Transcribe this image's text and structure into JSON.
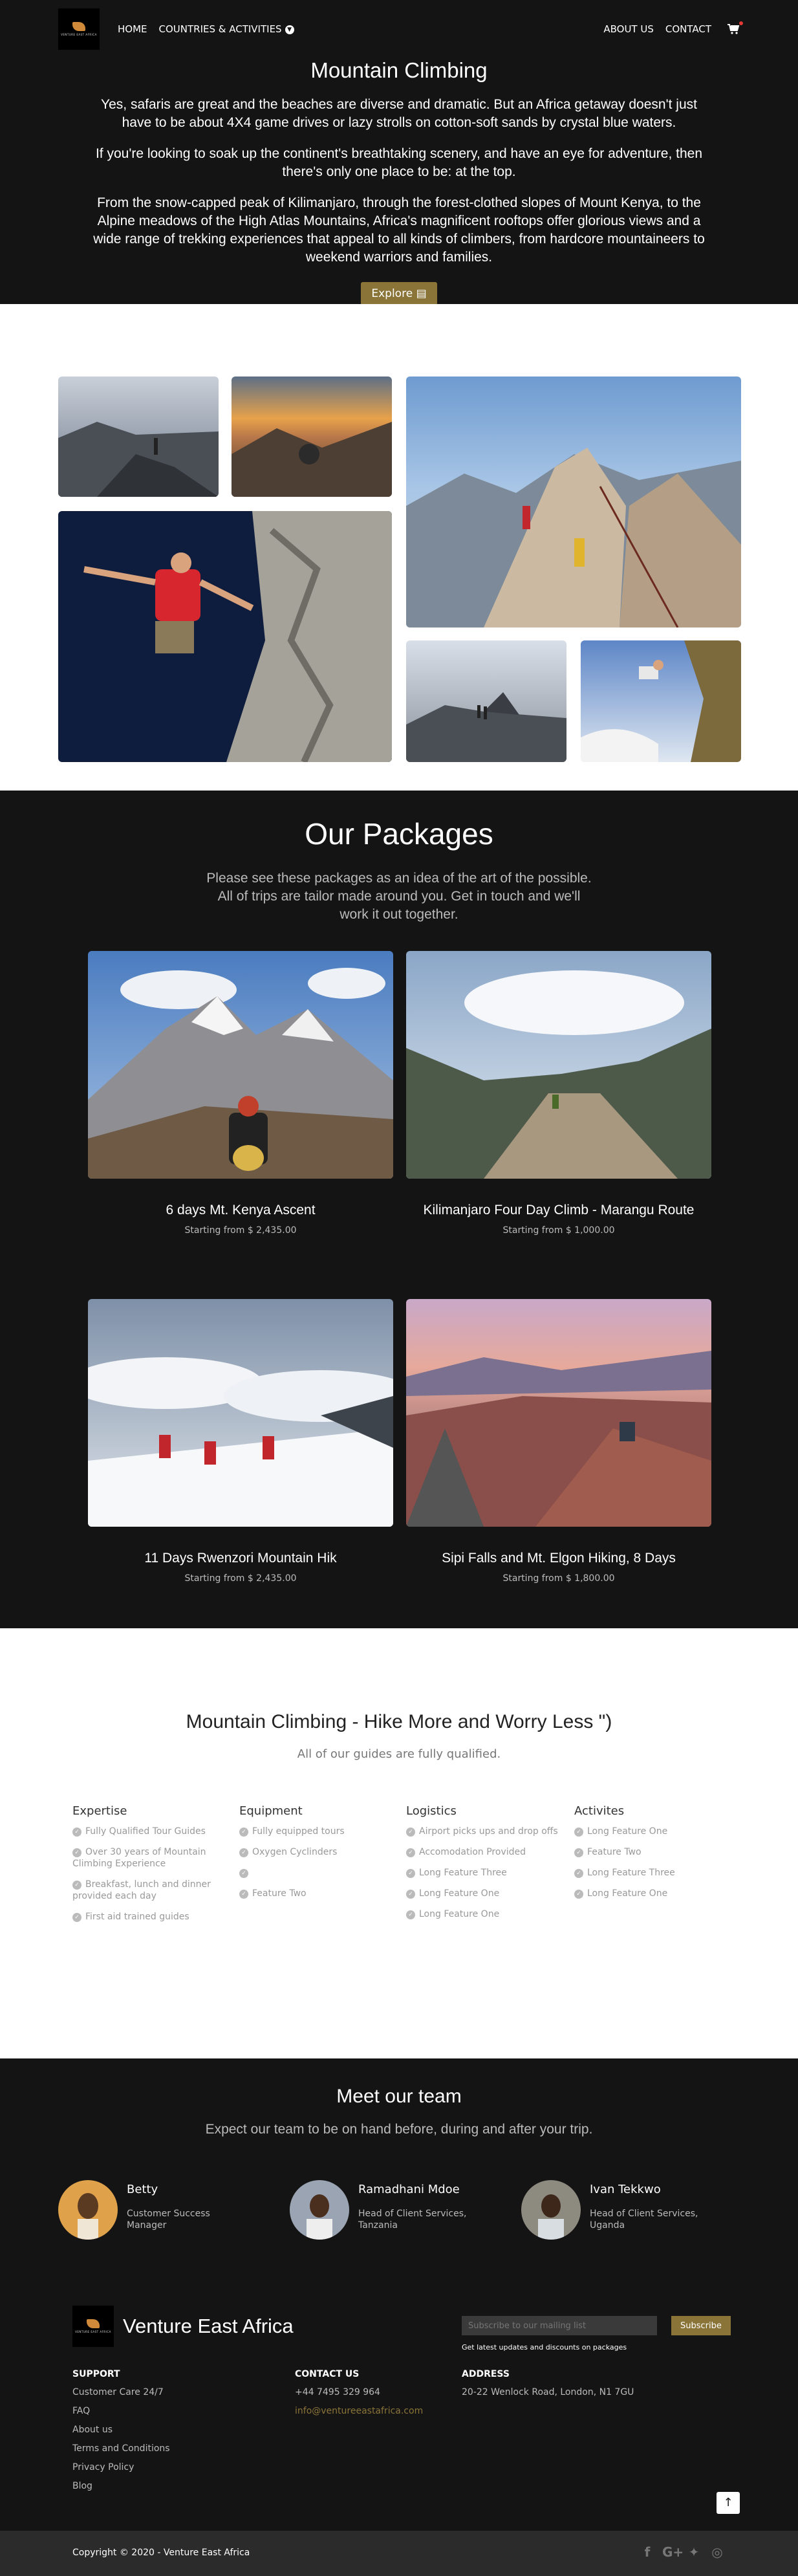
{
  "nav": {
    "logo_text": "VENTURE EAST AFRICA",
    "home": "HOME",
    "countries": "COUNTRIES & ACTIVITIES",
    "about": "ABOUT US",
    "contact": "CONTACT"
  },
  "hero": {
    "title": "Mountain Climbing",
    "p1": "Yes, safaris are great and the beaches are diverse and dramatic. But an Africa getaway doesn't just have to be about 4X4 game drives or lazy strolls on cotton-soft sands by crystal blue waters.",
    "p2": "If you're looking to soak up the continent's breathtaking scenery, and have an eye for adventure, then there's only one place to be: at the top.",
    "p3": "From the snow-capped peak of Kilimanjaro, through the forest-clothed slopes of Mount Kenya, to the Alpine meadows of the High Atlas Mountains, Africa's magnificent rooftops offer glorious views and a wide range of trekking experiences that appeal to all kinds of climbers, from hardcore mountaineers to weekend warriors and families.",
    "explore": "Explore"
  },
  "packages": {
    "title": "Our Packages",
    "lead": "Please see these packages as an idea of the art of the possible. All of trips are tailor made around you. Get in touch and we'll work it out together.",
    "items": [
      {
        "title": "6 days Mt. Kenya Ascent",
        "price": "Starting from  $ 2,435.00"
      },
      {
        "title": "Kilimanjaro Four Day Climb - Marangu Route",
        "price": "Starting from  $ 1,000.00"
      },
      {
        "title": "11 Days Rwenzori Mountain Hik",
        "price": "Starting from  $ 2,435.00"
      },
      {
        "title": "Sipi Falls and Mt. Elgon Hiking, 8 Days",
        "price": "Starting from  $ 1,800.00"
      }
    ]
  },
  "features": {
    "title": "Mountain Climbing - Hike More and Worry Less \")",
    "sub": "All of our guides are fully qualified.",
    "columns": [
      {
        "heading": "Expertise",
        "items": [
          "Fully Qualified Tour Guides",
          "Over 30 years of Mountain Climbing Experience",
          "Breakfast, lunch and dinner provided each day",
          "First aid trained guides"
        ]
      },
      {
        "heading": "Equipment",
        "items": [
          "Fully equipped tours",
          "Oxygen Cyclinders",
          "",
          "Feature Two"
        ]
      },
      {
        "heading": "Logistics",
        "items": [
          "Airport picks ups and drop offs",
          "Accomodation Provided",
          "Long Feature Three",
          "Long Feature One",
          "Long Feature One"
        ]
      },
      {
        "heading": "Activites",
        "items": [
          "Long Feature One",
          "Feature Two",
          "Long Feature Three",
          "Long Feature One"
        ]
      }
    ]
  },
  "team": {
    "title": "Meet our team",
    "sub": "Expect our team to be on hand before, during and after your trip.",
    "members": [
      {
        "name": "Betty",
        "role": "Customer Success Manager"
      },
      {
        "name": "Ramadhani Mdoe",
        "role": "Head of Client Services, Tanzania"
      },
      {
        "name": "Ivan Tekkwo",
        "role": "Head of Client Services, Uganda"
      }
    ]
  },
  "footer": {
    "brand": "Venture East Africa",
    "subscribe_placeholder": "Subscribe to our mailing list",
    "subscribe_btn": "Subscribe",
    "subscribe_note": "Get latest updates and discounts on packages",
    "support": {
      "heading": "SUPPORT",
      "links": [
        "Customer Care 24/7",
        "FAQ",
        "About us",
        "Terms and Conditions",
        "Privacy Policy",
        "Blog"
      ]
    },
    "contact": {
      "heading": "CONTACT US",
      "phone": "+44 7495 329 964",
      "email": "info@ventureeastafrica.com"
    },
    "address": {
      "heading": "ADDRESS",
      "line": "20-22 Wenlock Road, London, N1 7GU"
    },
    "copyright": "Copyright © 2020 - Venture East Africa"
  },
  "colors": {
    "dark": "#141414",
    "accent": "#8a7438",
    "footer_bottom": "#2b2b2b"
  },
  "icons": [
    "chevron-down-icon",
    "cart-icon",
    "document-icon",
    "check-icon",
    "arrow-up-icon",
    "facebook-icon",
    "google-plus-icon",
    "twitter-icon",
    "instagram-icon"
  ]
}
